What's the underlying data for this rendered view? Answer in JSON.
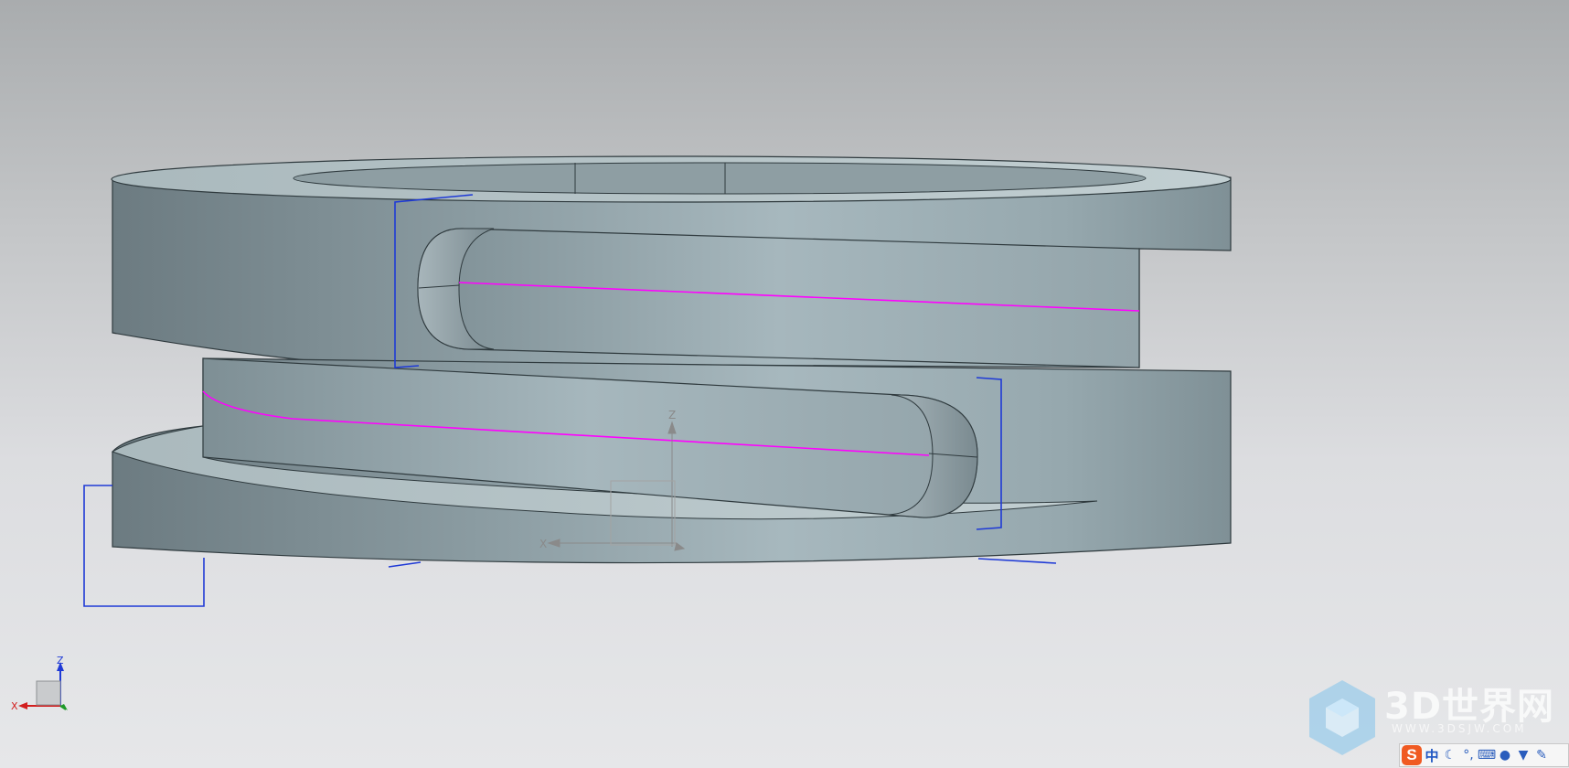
{
  "viewport": {
    "background_top": "#a9acae",
    "background_bottom": "#e6e7e9"
  },
  "model": {
    "part": "cylindrical-spring-ring",
    "face_color": "#9fb0b6",
    "edge_color": "#2f3a3e",
    "highlight_curve_color": "#ff00ff",
    "sketch_bracket_color": "#1f3ad6"
  },
  "work_csys": {
    "x_label": "X",
    "z_label": "Z"
  },
  "view_triad": {
    "x_label": "X",
    "z_label": "Z",
    "x_color": "#d21f1f",
    "z_color": "#1f3ad6",
    "y_color": "#1f9a2a"
  },
  "watermark": {
    "brand": "3D世界网",
    "url": "WWW.3DSJW.COM"
  },
  "ime_toolbar": {
    "logo": "S",
    "mode": "中",
    "icons": [
      "moon-icon",
      "punctuation-icon",
      "keyboard-icon",
      "user-icon",
      "skin-shirt-icon",
      "wrench-icon"
    ]
  }
}
